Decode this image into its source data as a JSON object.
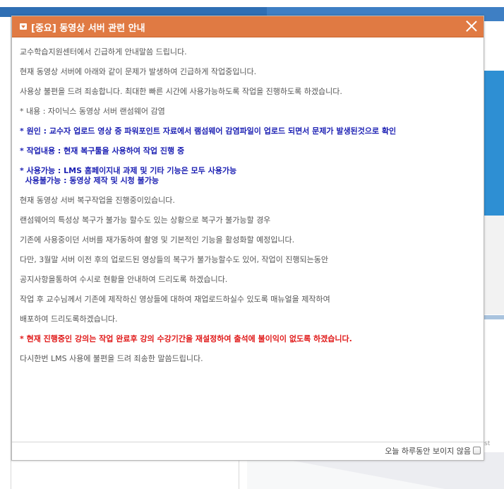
{
  "popup": {
    "title": "[중요] 동영상 서버 관련 안내",
    "lines": [
      "교수학습지원센터에서 긴급하게 안내말씀 드립니다.",
      "현재 동영상 서버에 아래와 같이 문제가 발생하여 긴급하게 작업중입니다.",
      "사용상 불편을 드려 죄송합니다. 최대한 빠른 시간에 사용가능하도록 작업을 진행하도록 하겠습니다.",
      "* 내용 : 자이닉스 동영상 서버 랜섬웨어 감염",
      "* 원인 : 교수자 업로드 영상 중 파워포인트 자료에서 램섬웨어 감염파일이 업로드 되면서 문제가 발생된것으로 확인",
      "* 작업내용 : 현재 복구툴을 사용하여 작업 진행 중",
      "* 사용가능 : LMS 홈페이지내 과제 및 기타 기능은 모두 사용가능",
      "  사용불가능 : 동영상 제작 및 시청 불가능",
      "현재 동영상 서버 복구작업을 진행중이있습니다.",
      "랜섬웨어의 특성상 복구가 불가능 할수도 있는 상황으로 복구가 불가능할 경우",
      "기존에 사용중이던 서버를 재가동하여 촬영 및 기본적인 기능을 활성화할 예정입니다.",
      "다만, 3월말 서버 이전 후의 업로드된 영상들의 복구가 불가능할수도 있어, 작업이 진행되는동안",
      "공지사항을통하여 수시로 현황을 안내하여 드리도록 하겠습니다.",
      "작업 후 교수님께서 기존에 제작하신 영상들에 대하여 재업로드하실수 있도록 매뉴얼을 제작하여",
      "배포하여 드리도록하겠습니다.",
      "* 현재 진행중인 강의는 작업 완료후 강의 수강기간을 재설정하여 출석에 불이익이 없도록 하겠습니다.",
      "다시한번 LMS 사용에 불편을 드려 죄송한 말씀드립니다."
    ],
    "footer_label": "오늘 하루동안 보이지 않음"
  },
  "background": {
    "corner_text": "st"
  },
  "colors": {
    "header": "#e07a43",
    "emphasis_blue": "#1b1fb3",
    "emphasis_red": "#e01818"
  }
}
